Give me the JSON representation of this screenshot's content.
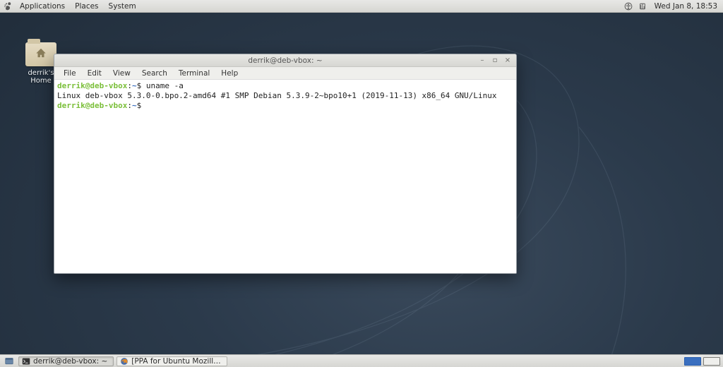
{
  "top_panel": {
    "menus": [
      "Applications",
      "Places",
      "System"
    ],
    "clock": "Wed Jan 8, 18:53",
    "tray": [
      "accessibility-icon",
      "network-icon"
    ]
  },
  "desktop": {
    "home_icon_label": "derrik's Home"
  },
  "terminal": {
    "title": "derrik@deb-vbox: ~",
    "menubar": [
      "File",
      "Edit",
      "View",
      "Search",
      "Terminal",
      "Help"
    ],
    "prompt_user": "derrik@deb-vbox",
    "prompt_path": "~",
    "prompt_symbol": "$",
    "lines": {
      "cmd1": "uname -a",
      "out1": "Linux deb-vbox 5.3.0-0.bpo.2-amd64 #1 SMP Debian 5.3.9-2~bpo10+1 (2019-11-13) x86_64 GNU/Linux"
    },
    "wincontrols": {
      "min": "–",
      "max": "▫",
      "close": "×"
    }
  },
  "bottom_panel": {
    "tasks": [
      {
        "label": "derrik@deb-vbox: ~",
        "icon": "terminal-icon",
        "active": true
      },
      {
        "label": "[PPA for Ubuntu Mozill…",
        "icon": "firefox-icon",
        "active": false
      }
    ],
    "workspaces": 2,
    "active_workspace": 0
  }
}
